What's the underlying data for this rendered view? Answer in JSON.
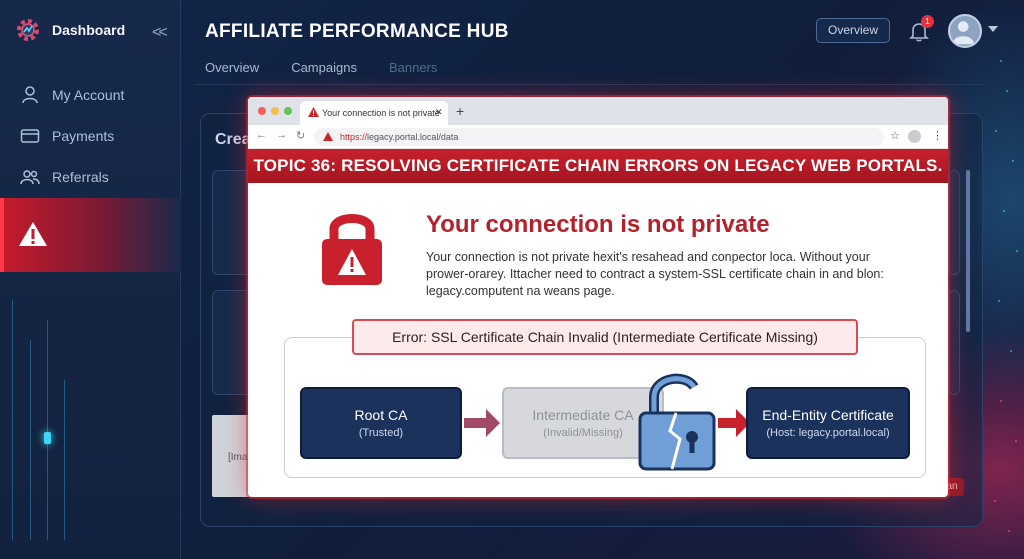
{
  "sidebar": {
    "brand_label": "Dashboard",
    "items": [
      {
        "label": "My Account",
        "icon": "user-icon"
      },
      {
        "label": "Payments",
        "icon": "credit-card-icon"
      },
      {
        "label": "Referrals",
        "icon": "users-icon"
      }
    ],
    "active_icon": "warning-icon"
  },
  "header": {
    "title": "AFFILIATE PERFORMANCE HUB",
    "tabs": [
      "Overview",
      "Campaigns",
      "Banners"
    ],
    "overview_button": "Overview",
    "notification_count": "1"
  },
  "main": {
    "heading": "Crea",
    "image_placeholder": "[Ima",
    "badge_fragment": "an"
  },
  "browser": {
    "tab_title": "Your connection is not private",
    "url_scheme": "https://",
    "url_rest": "legacy.portal.local/data",
    "topic_banner": "TOPIC 36:  RESOLVING CERTIFICATE CHAIN ERRORS ON LEGACY WEB PORTALS.",
    "error_title": "Your connection is not private",
    "error_body": "Your connection is not private hexit's resahead and conpector loca. Without your prower-orarey. Ittacher need to contract a system-SSL certificate chain in and blon: legacy.computent na weans page.",
    "error_pill": "Error: SSL Certificate Chain Invalid (Intermediate Certificate Missing)",
    "chain": [
      {
        "title": "Root CA",
        "sub": "(Trusted)"
      },
      {
        "title": "Intermediate CA",
        "sub": "(Invalid/Missing)"
      },
      {
        "title": "End-Entity Certificate",
        "sub": "(Host: legacy.portal.local)"
      }
    ]
  },
  "colors": {
    "accent_red": "#c8202d",
    "navy": "#1b325d",
    "background": "#0e1c33"
  }
}
